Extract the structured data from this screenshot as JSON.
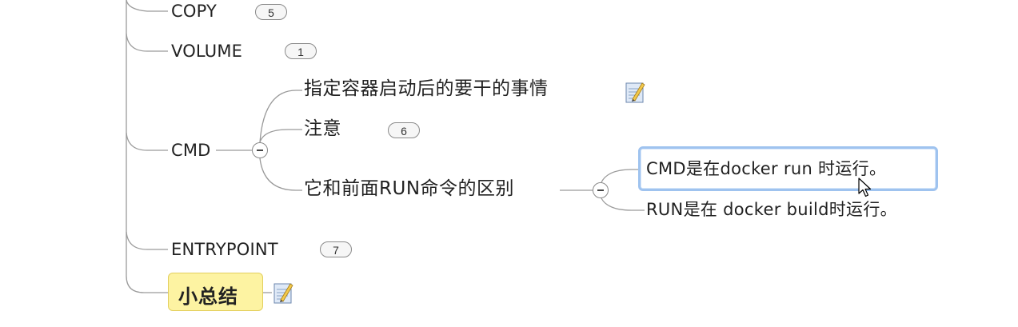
{
  "topics": {
    "copy": {
      "label": "COPY",
      "badge": "5"
    },
    "volume": {
      "label": "VOLUME",
      "badge": "1"
    },
    "cmd": {
      "label": "CMD",
      "children": {
        "purpose": {
          "label": "指定容器启动后的要干的事情",
          "has_note": true
        },
        "notice": {
          "label": "注意",
          "badge": "6"
        },
        "difference": {
          "label": "它和前面RUN命令的区别",
          "children": {
            "cmd_runtime": {
              "label": "CMD是在docker run 时运行。",
              "selected": true
            },
            "run_buildtime": {
              "label": "RUN是在 docker build时运行。"
            }
          }
        }
      }
    },
    "entrypoint": {
      "label": "ENTRYPOINT",
      "badge": "7"
    },
    "summary": {
      "label": "小总结",
      "has_note": true
    }
  },
  "colors": {
    "connector": "#9a9a9a",
    "selection_border": "#9fc3ef",
    "summary_fill": "#fdf3a2",
    "summary_border": "#e3cf5e"
  },
  "icons": [
    "note-icon",
    "collapse-icon",
    "mouse-cursor-icon"
  ]
}
